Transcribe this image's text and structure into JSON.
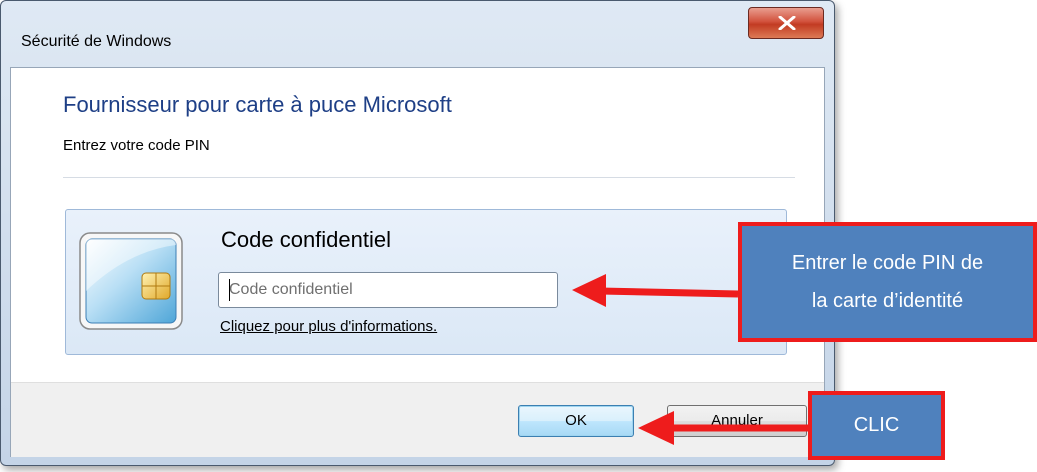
{
  "window": {
    "title": "Sécurité de Windows"
  },
  "dialog": {
    "provider_title": "Fournisseur pour carte à puce Microsoft",
    "provider_subtitle": "Entrez votre code PIN",
    "tile_heading": "Code confidentiel",
    "pin_placeholder": "Code confidentiel",
    "pin_value": "",
    "more_info_link": "Cliquez pour plus d'informations."
  },
  "buttons": {
    "ok_label": "OK",
    "cancel_label": "Annuler"
  },
  "annotations": {
    "pin_callout_line1": "Entrer le code PIN de",
    "pin_callout_line2": "la carte d’identité",
    "clic_callout": "CLIC"
  },
  "colors": {
    "callout_fill": "#4f81bd",
    "callout_border": "#ee1c1c",
    "arrow": "#ee1c1c",
    "provider_title": "#1e3f86"
  },
  "icons": {
    "close": "close-x-icon",
    "card": "smart-card-icon"
  }
}
